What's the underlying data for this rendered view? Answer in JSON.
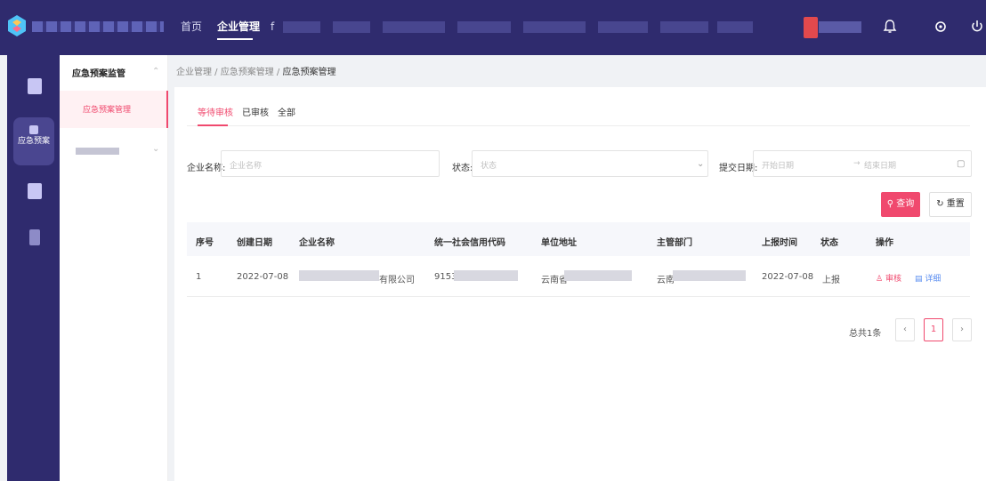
{
  "topnav": {
    "home": "首页",
    "enterprise": "企业管理",
    "partial": "f"
  },
  "sidebar": {
    "rail_active_label": "应急预案",
    "group_title": "应急预案监管",
    "active_item": "应急预案管理"
  },
  "breadcrumb": {
    "path": "企业管理 / 应急预案管理 / ",
    "current": "应急预案管理"
  },
  "tabs": [
    {
      "label": "等待审核",
      "active": true
    },
    {
      "label": "已审核",
      "active": false
    },
    {
      "label": "全部",
      "active": false
    }
  ],
  "filters": {
    "company_label": "企业名称:",
    "company_placeholder": "企业名称",
    "status_label": "状态:",
    "status_placeholder": "状态",
    "date_label": "提交日期:",
    "date_start_placeholder": "开始日期",
    "date_end_placeholder": "结束日期",
    "date_separator": "→"
  },
  "buttons": {
    "query": "查询",
    "reset": "重置"
  },
  "table": {
    "columns": [
      "序号",
      "创建日期",
      "企业名称",
      "统一社会信用代码",
      "单位地址",
      "主管部门",
      "上报时间",
      "状态",
      "操作"
    ],
    "rows": [
      {
        "index": "1",
        "created": "2022-07-08",
        "company_suffix": "有限公司",
        "credit_code_prefix": "9153",
        "address_prefix": "云南省",
        "dept_prefix": "云南",
        "report_time": "2022-07-08",
        "status": "上报",
        "op_review": "审核",
        "op_detail": "详细"
      }
    ]
  },
  "pagination": {
    "total": "总共1条",
    "prev": "‹",
    "current_page": "1",
    "next": "›"
  }
}
